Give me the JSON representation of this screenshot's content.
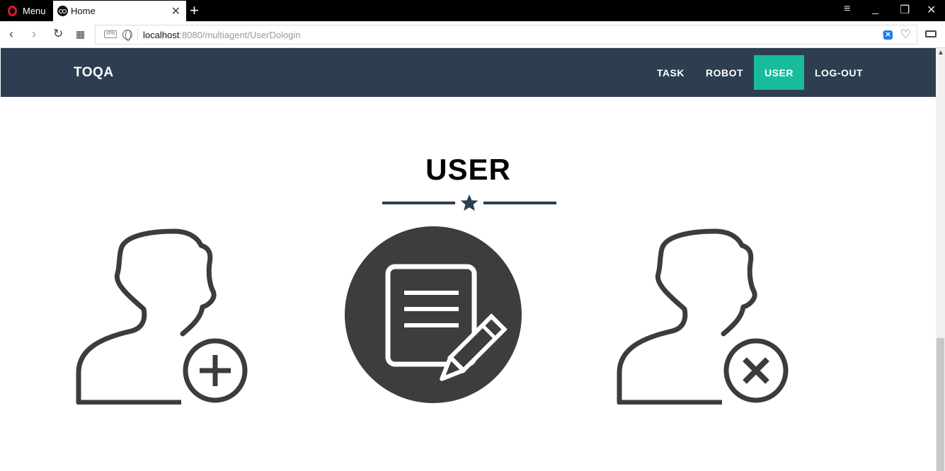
{
  "browser": {
    "menu_label": "Menu",
    "tab_title": "Home",
    "url_host": "localhost",
    "url_path": ":8080/multiagent/UserDologin",
    "vpn_label": "VPN",
    "blocked_count": "0",
    "accent_color": "#e3142d"
  },
  "navbar": {
    "brand": "TOQA",
    "items": [
      {
        "label": "TASK",
        "active": false
      },
      {
        "label": "ROBOT",
        "active": false
      },
      {
        "label": "USER",
        "active": true
      },
      {
        "label": "LOG-OUT",
        "active": false
      }
    ],
    "bg_color": "#2c3e50",
    "active_color": "#18bc9c"
  },
  "main": {
    "title": "USER",
    "divider_icon": "star-icon",
    "actions": [
      {
        "icon": "add-user-icon"
      },
      {
        "icon": "edit-document-icon"
      },
      {
        "icon": "remove-user-icon"
      }
    ]
  }
}
